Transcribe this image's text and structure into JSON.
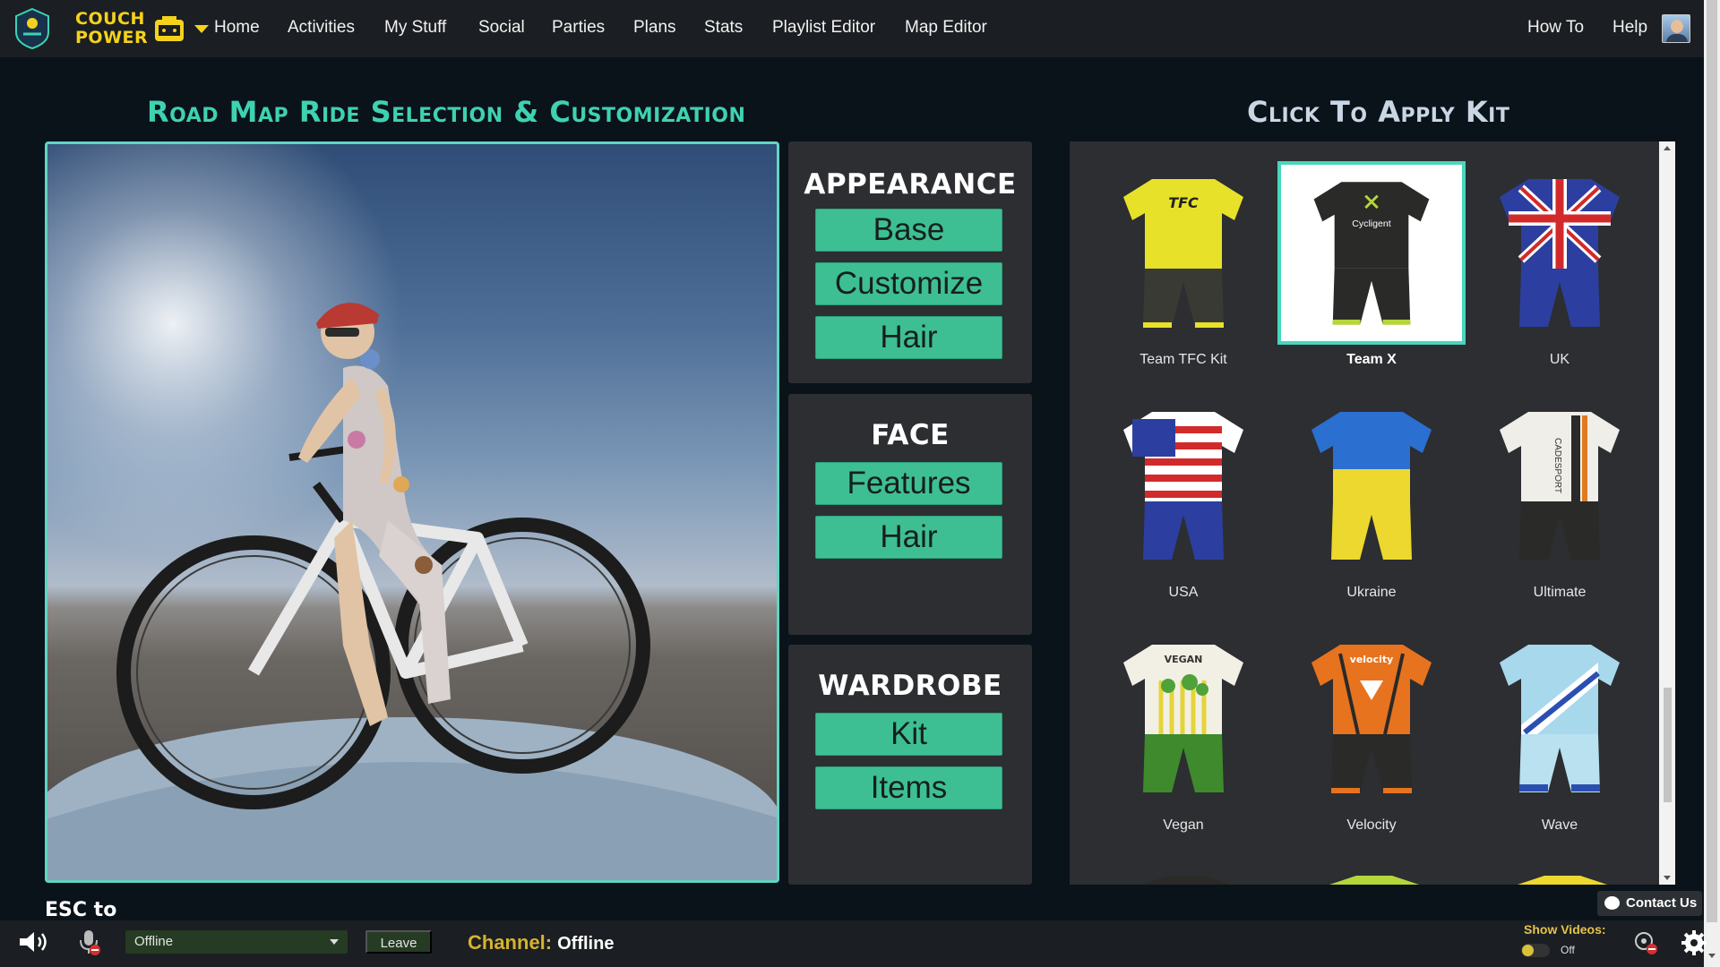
{
  "logo": {
    "line1": "COUCH",
    "line2": "POWER"
  },
  "nav": {
    "items": [
      "Home",
      "Activities",
      "My Stuff",
      "Social",
      "Parties",
      "Plans",
      "Stats",
      "Playlist Editor",
      "Map Editor"
    ],
    "right": [
      "How To",
      "Help"
    ]
  },
  "headings": {
    "left": "Road Map Ride Selection & Customization",
    "right": "Click To Apply Kit"
  },
  "panels": {
    "appearance": {
      "title": "APPEARANCE",
      "buttons": [
        "Base",
        "Customize",
        "Hair"
      ]
    },
    "face": {
      "title": "FACE",
      "buttons": [
        "Features",
        "Hair"
      ]
    },
    "wardrobe": {
      "title": "WARDROBE",
      "buttons": [
        "Kit",
        "Items"
      ]
    }
  },
  "kits": [
    {
      "label": "Team TFC Kit",
      "selected": false
    },
    {
      "label": "Team X",
      "selected": true
    },
    {
      "label": "UK",
      "selected": false
    },
    {
      "label": "USA",
      "selected": false
    },
    {
      "label": "Ukraine",
      "selected": false
    },
    {
      "label": "Ultimate",
      "selected": false
    },
    {
      "label": "Vegan",
      "selected": false
    },
    {
      "label": "Velocity",
      "selected": false
    },
    {
      "label": "Wave",
      "selected": false
    }
  ],
  "kit_print": {
    "tfc": "TFC",
    "cycligent": "Cycligent",
    "vegan": "VEGAN",
    "velocity": "velocity",
    "ultimate": "CADESPORT"
  },
  "esc_hint": "ESC to",
  "bottom": {
    "status_select": "Offline",
    "leave": "Leave",
    "channel_label": "Channel:",
    "channel_value": "Offline",
    "contact": "Contact Us",
    "show_videos": "Show Videos:",
    "toggle_state": "Off"
  },
  "colors": {
    "accent": "#3ebf93",
    "heading_teal": "#3ed2b1",
    "logo_yellow": "#f4d21c",
    "channel_gold": "#d4b32e"
  }
}
